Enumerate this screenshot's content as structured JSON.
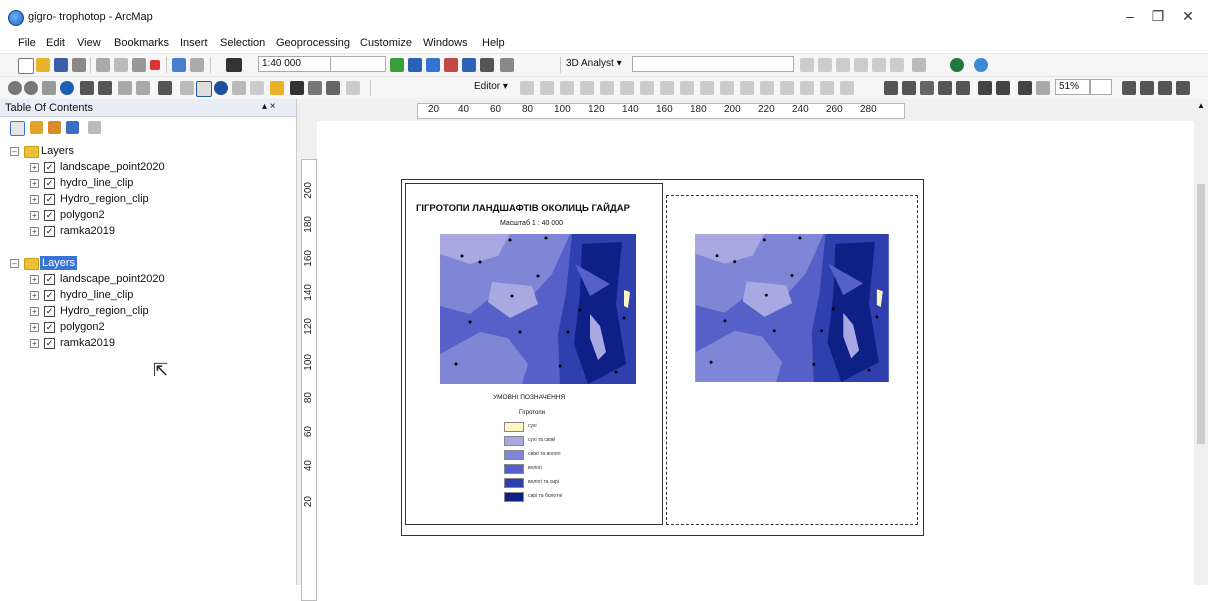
{
  "window": {
    "title": "gigro- trophotop - ArcMap"
  },
  "menu": [
    "File",
    "Edit",
    "View",
    "Bookmarks",
    "Insert",
    "Selection",
    "Geoprocessing",
    "Customize",
    "Windows",
    "Help"
  ],
  "toolbar": {
    "scale": "1:40 000",
    "analyst_label": "3D Analyst ▾",
    "editor_label": "Editor ▾",
    "zoom": "51%"
  },
  "toc": {
    "title": "Table Of Contents",
    "pin": "▴ ×",
    "groups": [
      {
        "name": "Layers",
        "selected": false,
        "layers": [
          "landscape_point2020",
          "hydro_line_clip",
          "Hydro_region_clip",
          "polygon2",
          "ramka2019"
        ]
      },
      {
        "name": "Layers",
        "selected": true,
        "layers": [
          "landscape_point2020",
          "hydro_line_clip",
          "Hydro_region_clip",
          "polygon2",
          "ramka2019"
        ]
      }
    ]
  },
  "rulers": {
    "h": [
      "20",
      "40",
      "60",
      "80",
      "100",
      "120",
      "140",
      "160",
      "180",
      "200",
      "220",
      "240",
      "260",
      "280"
    ],
    "v": [
      "200",
      "180",
      "160",
      "140",
      "120",
      "100",
      "80",
      "60",
      "40",
      "20"
    ]
  },
  "layout": {
    "map_title": "ГІГРОТОПИ ЛАНДШАФТІВ ОКОЛИЦЬ ГАЙДАР",
    "scale_text": "Масштаб 1 : 40 000",
    "legend_title": "УМОВНІ ПОЗНАЧЕННЯ",
    "legend_subtitle": "Гігротопи",
    "legend_items": [
      {
        "label": "сухі",
        "color": "#fbf6c4"
      },
      {
        "label": "сухі та свіжі",
        "color": "#a8a8e2"
      },
      {
        "label": "свіжі та вологі",
        "color": "#7f86d6"
      },
      {
        "label": "вологі",
        "color": "#5560c8"
      },
      {
        "label": "вологі та сирі",
        "color": "#2f3fae"
      },
      {
        "label": "сирі та болотні",
        "color": "#0e1f86"
      }
    ]
  },
  "colors": {
    "toc_selected": "#3875d7",
    "map_light": "#a8a8e2",
    "map_mid": "#5560c8",
    "map_dark": "#0e1f86"
  }
}
